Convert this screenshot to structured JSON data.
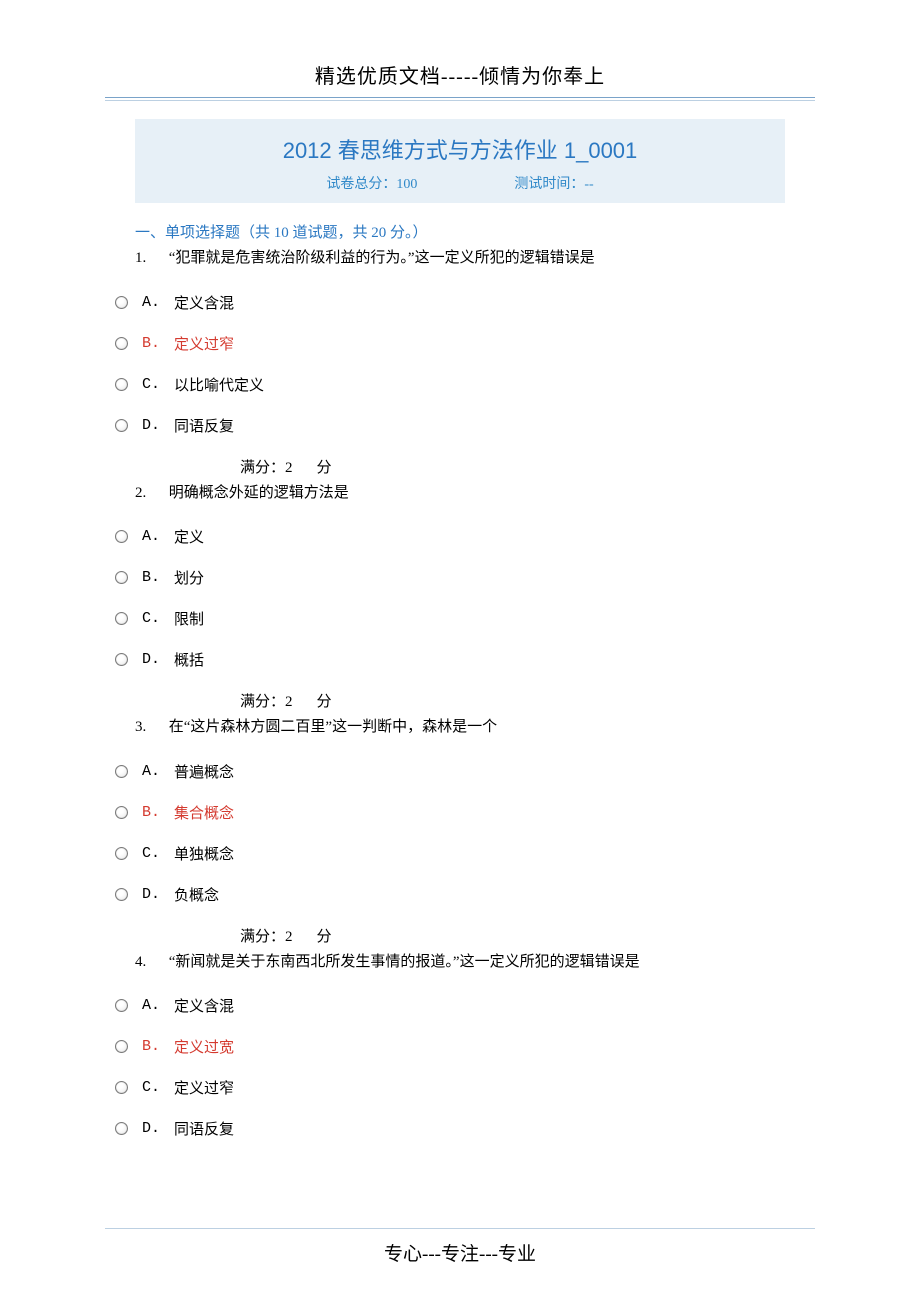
{
  "header": "精选优质文档-----倾情为你奉上",
  "title": "2012 春思维方式与方法作业 1_0001",
  "exam_info": {
    "score_label": "试卷总分：",
    "score_value": "100",
    "time_label": "测试时间：",
    "time_value": "--"
  },
  "section": {
    "heading": "一、单项选择题（共  10  道试题，共  20  分。）"
  },
  "score_text": {
    "prefix": "满分：2",
    "suffix": "分"
  },
  "questions": [
    {
      "num": "1.",
      "text": "“犯罪就是危害统治阶级利益的行为。”这一定义所犯的逻辑错误是",
      "options": [
        {
          "label": "A.",
          "text": "定义含混",
          "highlight": false
        },
        {
          "label": "B.",
          "text": "定义过窄",
          "highlight": true
        },
        {
          "label": "C.",
          "text": "以比喻代定义",
          "highlight": false
        },
        {
          "label": "D.",
          "text": "同语反复",
          "highlight": false
        }
      ]
    },
    {
      "num": "2.",
      "text": "明确概念外延的逻辑方法是",
      "options": [
        {
          "label": "A.",
          "text": "定义",
          "highlight": false
        },
        {
          "label": "B.",
          "text": "划分",
          "highlight": false
        },
        {
          "label": "C.",
          "text": "限制",
          "highlight": false
        },
        {
          "label": "D.",
          "text": "概括",
          "highlight": false
        }
      ]
    },
    {
      "num": "3.",
      "text": "在“这片森林方圆二百里”这一判断中，森林是一个",
      "options": [
        {
          "label": "A.",
          "text": "普遍概念",
          "highlight": false
        },
        {
          "label": "B.",
          "text": "集合概念",
          "highlight": true
        },
        {
          "label": "C.",
          "text": "单独概念",
          "highlight": false
        },
        {
          "label": "D.",
          "text": "负概念",
          "highlight": false
        }
      ]
    },
    {
      "num": "4.",
      "text": "“新闻就是关于东南西北所发生事情的报道。”这一定义所犯的逻辑错误是",
      "options": [
        {
          "label": "A.",
          "text": "定义含混",
          "highlight": false
        },
        {
          "label": "B.",
          "text": "定义过宽",
          "highlight": true
        },
        {
          "label": "C.",
          "text": "定义过窄",
          "highlight": false
        },
        {
          "label": "D.",
          "text": "同语反复",
          "highlight": false
        }
      ]
    }
  ],
  "footer": "专心---专注---专业"
}
